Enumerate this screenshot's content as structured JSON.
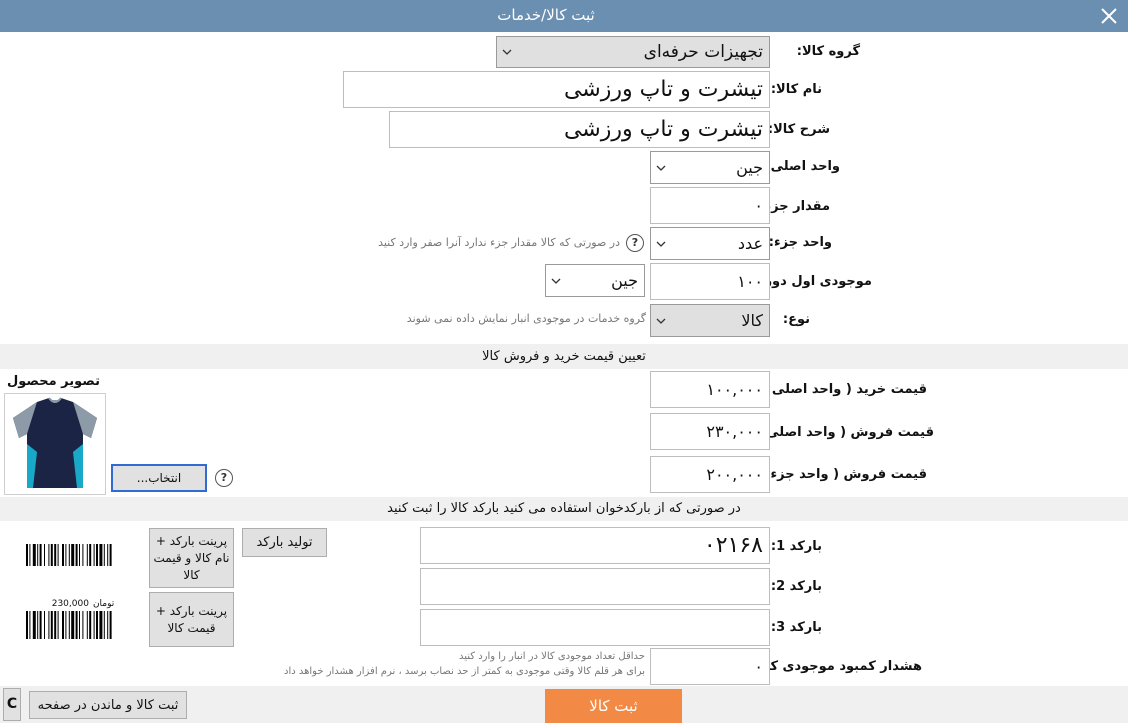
{
  "window": {
    "title": "ثبت کالا/خدمات"
  },
  "form": {
    "group": {
      "label": "گروه کالا:",
      "value": "تجهیزات حرفه‌ای"
    },
    "name": {
      "label": "نام کالا:",
      "value": "تیشرت و تاپ ورزشی"
    },
    "desc": {
      "label": "شرح کالا:",
      "value": "تیشرت و تاپ ورزشی"
    },
    "main_unit": {
      "label": "واحد اصلی:",
      "value": "جین"
    },
    "part_qty": {
      "label": "مقدار جزء:",
      "value": "۰"
    },
    "part_unit": {
      "label": "واحد جزء:",
      "value": "عدد",
      "hint": "در صورتی که کالا مقدار جزء ندارد آنرا صفر وارد کنید"
    },
    "opening_stock": {
      "label": "موجودی اول دوره:",
      "value": "۱۰۰",
      "unit": "جین"
    },
    "type": {
      "label": "نوع:",
      "value": "کالا",
      "hint": "گروه خدمات در موجودی انبار نمایش داده نمی شوند"
    }
  },
  "pricing": {
    "header": "تعیین قیمت خرید و فروش کالا",
    "buy": {
      "label": "قیمت خرید ( واحد اصلی ) :",
      "value": "۱۰۰,۰۰۰"
    },
    "sell_main": {
      "label": "قیمت فروش ( واحد اصلی ) :",
      "value": "۲۳۰,۰۰۰"
    },
    "sell_part": {
      "label": "قیمت فروش ( واحد جزء ) :",
      "value": "۲۰۰,۰۰۰"
    },
    "image_title": "تصویر محصول",
    "choose_label": "انتخاب...",
    "help": "?"
  },
  "barcode": {
    "header": "در صورتی که از بارکدخوان استفاده می کنید بارکد کالا را ثبت کنید",
    "b1": {
      "label": "بارکد 1:",
      "value": "۰۲۱۶۸"
    },
    "b2": {
      "label": "بارکد 2:",
      "value": ""
    },
    "b3": {
      "label": "بارکد 3:",
      "value": ""
    },
    "generate_label": "تولید بارکد",
    "print_full_label": "پرینت بارکد + نام کالا و قیمت کالا",
    "print_price_label": "پرینت بارکد + قیمت کالا",
    "sample_price": "230,000",
    "sample_currency": "تومان",
    "warning": {
      "label": "هشدار کمبود موجودی کالا:",
      "value": "۰",
      "hint_1": "حداقل تعداد موجودی کالا در انبار را وارد کنید",
      "hint_2": "برای هر قلم کالا وقتی موجودی به کمتر از حد نصاب برسد ، نرم افزار هشدار خواهد داد"
    }
  },
  "footer": {
    "c_label": "C",
    "save_stay_label": "ثبت کالا و ماندن در صفحه",
    "submit_label": "ثبت کالا"
  },
  "colors": {
    "titlebar": "#6b8fb0",
    "submit": "#f28a46",
    "band": "#f0f0f0"
  },
  "icons": [
    "close-icon",
    "chevron-down-icon",
    "help-icon",
    "barcode-icon"
  ]
}
